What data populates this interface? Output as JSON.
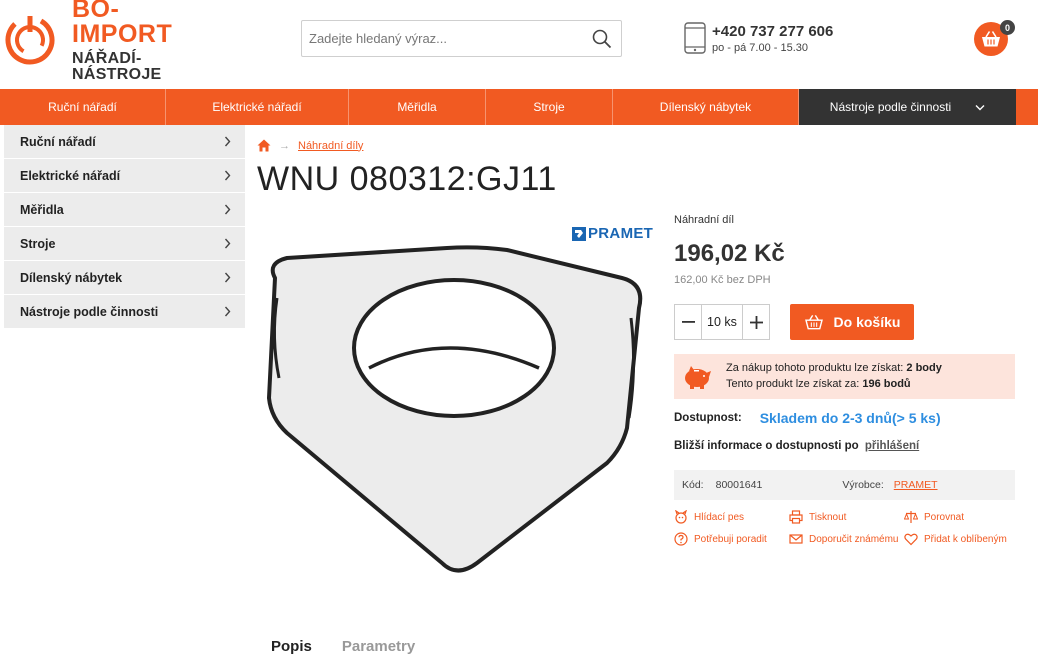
{
  "brand": {
    "line1": "BO-IMPORT",
    "line2": "NÁŘADÍ-NÁSTROJE",
    "accent_color": "#f15a22"
  },
  "search": {
    "placeholder": "Zadejte hledaný výraz...",
    "icon": "search-icon"
  },
  "contact": {
    "phone": "+420 737 277 606",
    "hours": "po - pá 7.00 - 15.30"
  },
  "cart": {
    "count": "0"
  },
  "nav": {
    "items": [
      {
        "label": "Ruční nářadí"
      },
      {
        "label": "Elektrické nářadí"
      },
      {
        "label": "Měřidla"
      },
      {
        "label": "Stroje"
      },
      {
        "label": "Dílenský nábytek"
      },
      {
        "label": "Nástroje podle činnosti"
      }
    ]
  },
  "sidebar": {
    "items": [
      {
        "label": "Ruční nářadí"
      },
      {
        "label": "Elektrické nářadí"
      },
      {
        "label": "Měřidla"
      },
      {
        "label": "Stroje"
      },
      {
        "label": "Dílenský nábytek"
      },
      {
        "label": "Nástroje podle činnosti"
      }
    ]
  },
  "breadcrumb": {
    "items": [
      "Náhradní díly"
    ]
  },
  "product": {
    "title": "WNU 080312:GJ11",
    "brand_logo": "PRAMET",
    "type": "Náhradní díl",
    "price": "196,02 Kč",
    "price_no_vat": "162,00 Kč bez DPH",
    "qty": "10 ks",
    "add_to_cart": "Do košíku",
    "points": {
      "line1_prefix": "Za nákup tohoto produktu lze získat:",
      "line1_value": "2 body",
      "line2_prefix": "Tento produkt lze získat za:",
      "line2_value": "196 bodů"
    },
    "availability_label": "Dostupnost:",
    "availability_value": "Skladem do 2-3 dnů(> 5 ks)",
    "availability_more": "Bližší informace o dostupnosti po",
    "availability_link": "přihlášení",
    "code_label": "Kód:",
    "code_value": "80001641",
    "maker_label": "Výrobce:",
    "maker_value": "PRAMET",
    "actions": [
      {
        "label": "Hlídací pes",
        "icon": "dog-icon"
      },
      {
        "label": "Tisknout",
        "icon": "printer-icon"
      },
      {
        "label": "Porovnat",
        "icon": "scales-icon"
      },
      {
        "label": "Potřebuji poradit",
        "icon": "help-icon"
      },
      {
        "label": "Doporučit známému",
        "icon": "envelope-icon"
      },
      {
        "label": "Přidat k oblíbeným",
        "icon": "heart-icon"
      }
    ]
  },
  "tabs": [
    {
      "label": "Popis"
    },
    {
      "label": "Parametry"
    }
  ]
}
